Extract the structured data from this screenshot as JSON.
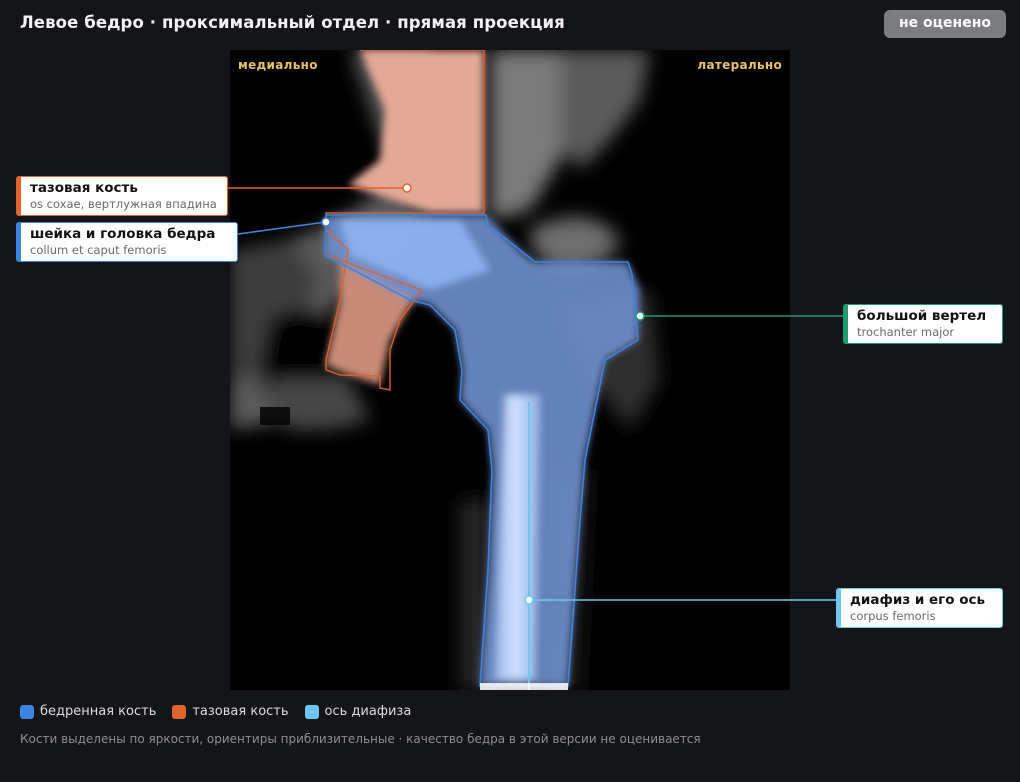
{
  "header": {
    "title": "Левое бедро · проксимальный отдел · прямая проекция",
    "status_badge": "не оценено"
  },
  "viewer": {
    "orientation_left": "медиально",
    "orientation_right": "латерально"
  },
  "annotations": [
    {
      "key": "pelvis",
      "name": "тазовая кость",
      "latin": "os coxae, вертлужная впадина",
      "color": "#e0622e"
    },
    {
      "key": "neck_head",
      "name": "шейка и головка бедра",
      "latin": "collum et caput femoris",
      "color": "#3d83e0"
    },
    {
      "key": "trochanter",
      "name": "большой вертел",
      "latin": "trochanter major",
      "color": "#1e9b6e"
    },
    {
      "key": "shaft",
      "name": "диафиз и его ось",
      "latin": "corpus femoris",
      "color": "#6cc8ec"
    }
  ],
  "legend": [
    {
      "label": "бедренная кость",
      "color": "#3d83e0"
    },
    {
      "label": "тазовая кость",
      "color": "#e0622e"
    },
    {
      "label": "ось диафиза",
      "color": "#6cc8ec"
    }
  ],
  "footnote": "Кости выделены по яркости, ориентиры приблизительные · качество бедра в этой версии не оценивается"
}
